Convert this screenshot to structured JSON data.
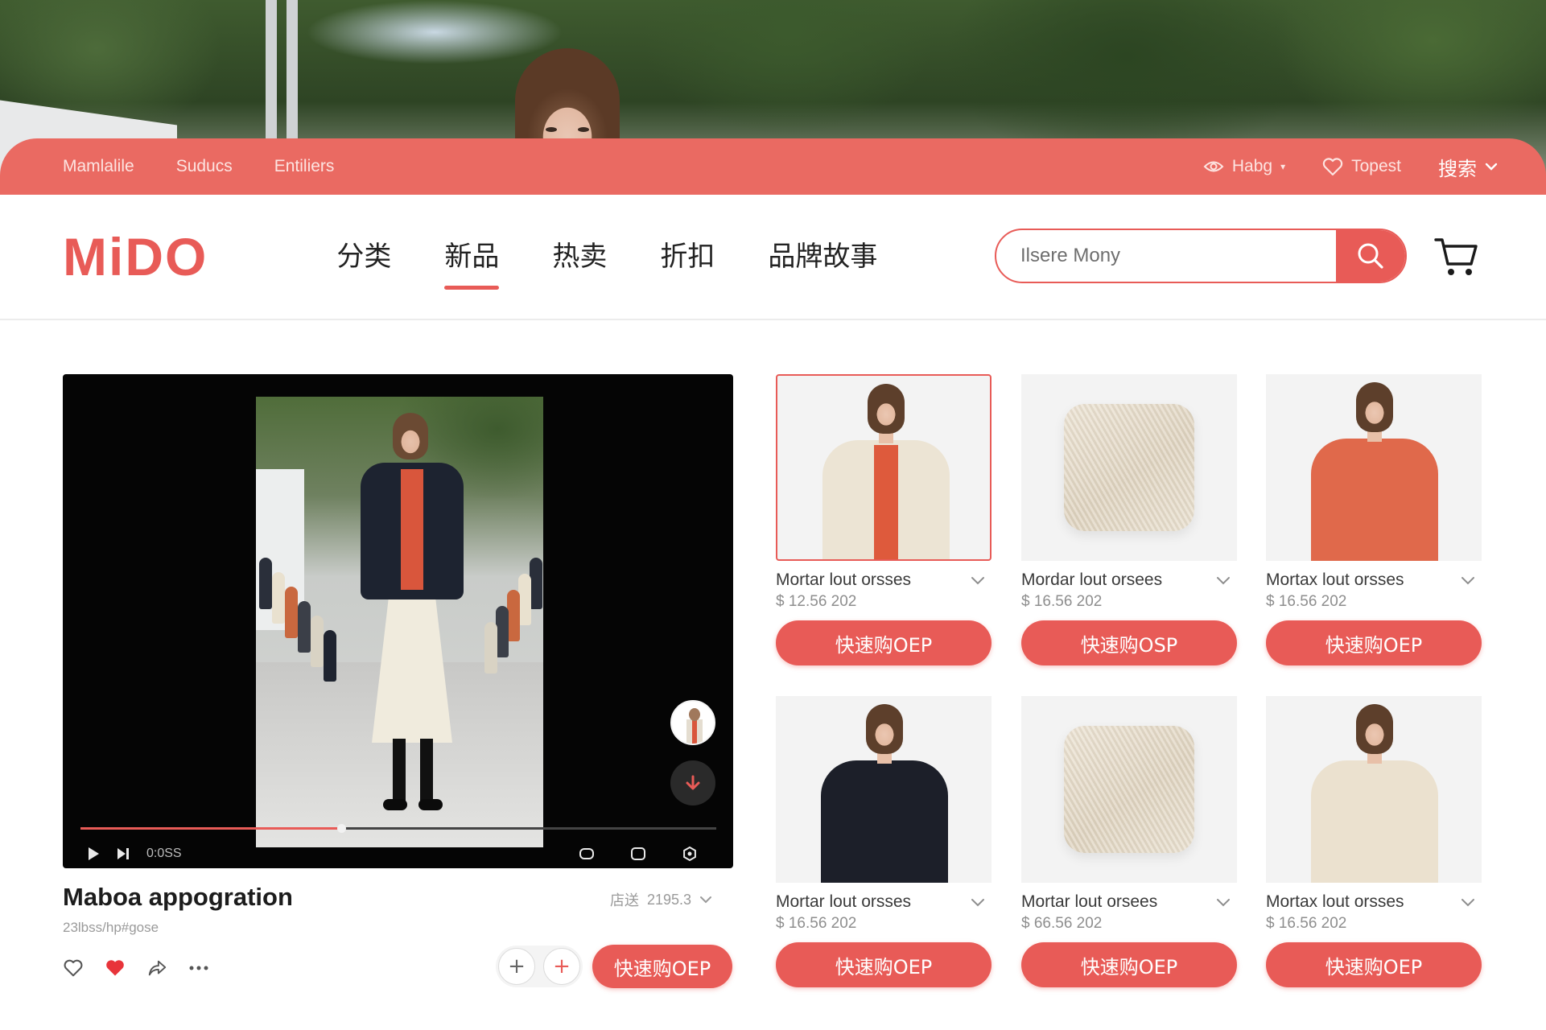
{
  "colors": {
    "accent": "#e85b57",
    "topbar": "#ea6a62"
  },
  "topbar": {
    "links": [
      "Mamlalile",
      "Suducs",
      "Entiliers"
    ],
    "right": [
      {
        "icon": "eye-icon",
        "label": "Habg"
      },
      {
        "icon": "heart-outline-icon",
        "label": "Topest"
      },
      {
        "icon": "chevron-down-icon",
        "label": "搜索"
      }
    ]
  },
  "header": {
    "logo": "MiDO",
    "nav": [
      {
        "label": "分类",
        "active": false
      },
      {
        "label": "新品",
        "active": true
      },
      {
        "label": "热卖",
        "active": false
      },
      {
        "label": "折扣",
        "active": false
      },
      {
        "label": "品牌故事",
        "active": false
      }
    ],
    "search_placeholder": "Ilsere Mony",
    "search_icon": "search-icon",
    "cart_icon": "cart-icon"
  },
  "video": {
    "time": "0:0SS",
    "progress": 0.41,
    "title": "Maboa appogration",
    "subtitle": "23lbss/hp#gose",
    "stats_label": "店送",
    "stats_value": "2195.3",
    "buy_label": "快速购OEP"
  },
  "products": [
    {
      "name": "Mortar lout orsses",
      "price": "$ 12.56 202",
      "buy": "快速购OEP",
      "art": "model-beige-coat",
      "selected": true
    },
    {
      "name": "Mordar lout orsees",
      "price": "$ 16.56 202",
      "buy": "快速购OSP",
      "art": "fabric"
    },
    {
      "name": "Mortax lout orsses",
      "price": "$ 16.56 202",
      "buy": "快速购OEP",
      "art": "model-red-dress"
    },
    {
      "name": "Mortar lout orsses",
      "price": "$ 16.56 202",
      "buy": "快速购OEP",
      "art": "model-black-hoodie"
    },
    {
      "name": "Mortar lout orsees",
      "price": "$ 66.56 202",
      "buy": "快速购OEP",
      "art": "fabric"
    },
    {
      "name": "Mortax lout orsses",
      "price": "$ 16.56 202",
      "buy": "快速购OEP",
      "art": "model-cream-dress"
    }
  ]
}
